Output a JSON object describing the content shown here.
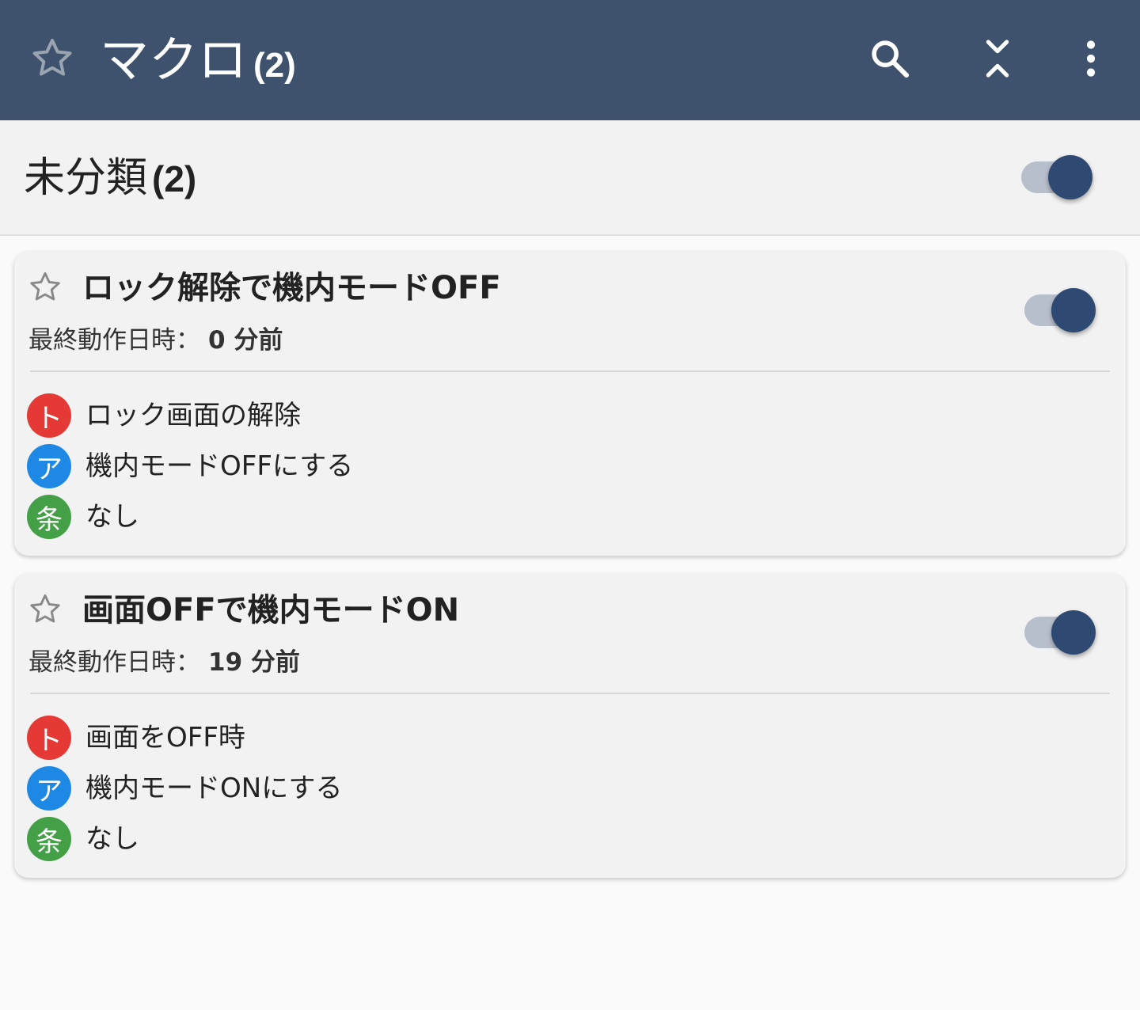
{
  "appbar": {
    "title": "マクロ",
    "count": "(2)",
    "icons": {
      "favorite": "star-outline-icon",
      "search": "search-icon",
      "collapse": "collapse-all-icon",
      "more": "more-vert-icon"
    }
  },
  "group": {
    "title": "未分類",
    "count": "(2)",
    "enabled": true
  },
  "colors": {
    "appbar": "#3e526d",
    "toggle_on": "#2f4a72",
    "trigger": "#e53935",
    "action": "#1e88e5",
    "constraint": "#43a047"
  },
  "macros": [
    {
      "title": "ロック解除で機内モードOFF",
      "last_run_label": "最終動作日時：",
      "last_run_value": "0 分前",
      "enabled": true,
      "trigger": {
        "badge": "ト",
        "text": "ロック画面の解除"
      },
      "action": {
        "badge": "ア",
        "text": "機内モードOFFにする"
      },
      "constraint": {
        "badge": "条",
        "text": "なし"
      }
    },
    {
      "title": "画面OFFで機内モードON",
      "last_run_label": "最終動作日時：",
      "last_run_value": "19 分前",
      "enabled": true,
      "trigger": {
        "badge": "ト",
        "text": "画面をOFF時"
      },
      "action": {
        "badge": "ア",
        "text": "機内モードONにする"
      },
      "constraint": {
        "badge": "条",
        "text": "なし"
      }
    }
  ]
}
